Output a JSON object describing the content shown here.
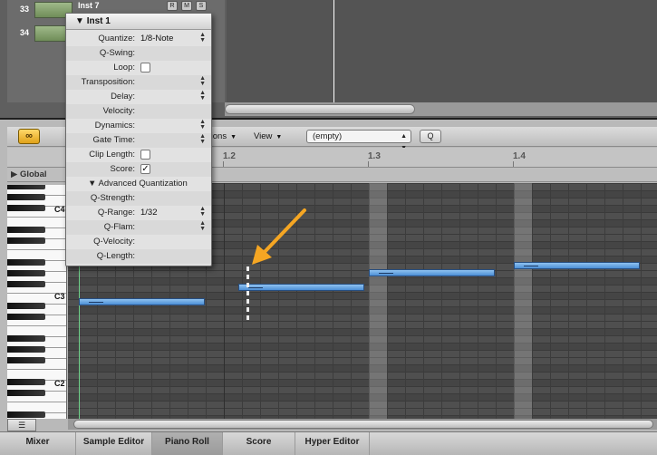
{
  "arrange": {
    "tracks": [
      {
        "number": "33",
        "name": "Inst 7",
        "buttons": [
          "R",
          "M",
          "S"
        ]
      },
      {
        "number": "34",
        "name": "",
        "buttons": []
      }
    ]
  },
  "toolbar": {
    "menus": [
      "tions",
      "View"
    ],
    "select_value": "(empty)",
    "search_label": "Q"
  },
  "ruler": {
    "labels": [
      "1.2",
      "1.3",
      "1.4"
    ]
  },
  "global_row": {
    "label": "Global"
  },
  "keyboard": {
    "octaves": [
      "C4",
      "C3",
      "C2"
    ]
  },
  "inspector": {
    "title": "Inst 1",
    "rows": [
      {
        "label": "Quantize:",
        "value": "1/8-Note",
        "stepper": true
      },
      {
        "label": "Q-Swing:",
        "value": ""
      },
      {
        "label": "Loop:",
        "check": "unchecked"
      },
      {
        "label": "Transposition:",
        "value": "",
        "stepper": true
      },
      {
        "label": "Delay:",
        "value": "",
        "stepper": true
      },
      {
        "label": "Velocity:",
        "value": ""
      },
      {
        "label": "Dynamics:",
        "value": "",
        "stepper": true
      },
      {
        "label": "Gate Time:",
        "value": "",
        "stepper": true
      },
      {
        "label": "Clip Length:",
        "check": "unchecked"
      },
      {
        "label": "Score:",
        "check": "checked"
      },
      {
        "subheader": "Advanced Quantization"
      },
      {
        "label": "Q-Strength:",
        "value": ""
      },
      {
        "label": "Q-Range:",
        "value": "1/32",
        "stepper": true
      },
      {
        "label": "Q-Flam:",
        "value": "",
        "stepper": true
      },
      {
        "label": "Q-Velocity:",
        "value": ""
      },
      {
        "label": "Q-Length:",
        "value": ""
      }
    ]
  },
  "tabs": [
    {
      "label": "Mixer",
      "active": false
    },
    {
      "label": "Sample Editor",
      "active": false
    },
    {
      "label": "Piano Roll",
      "active": true
    },
    {
      "label": "Score",
      "active": false
    },
    {
      "label": "Hyper Editor",
      "active": false
    }
  ],
  "icons": {
    "link": "link-icon",
    "disclosure": "disclosure-triangle-icon",
    "stepper": "stepper-arrows-icon",
    "checkmark": "checkmark-icon",
    "annotation": "annotation-arrow-icon"
  },
  "colors": {
    "note_fill": "#5b9be0",
    "annotation_arrow": "#f5a623",
    "playhead": "#6fd18a",
    "link_button": "#f0b83a"
  }
}
